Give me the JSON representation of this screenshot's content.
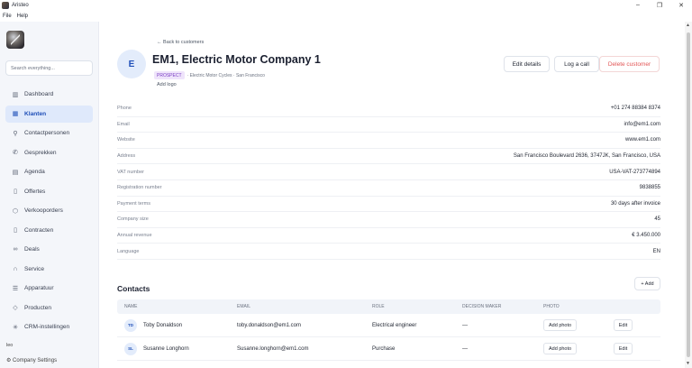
{
  "window": {
    "title": "Aristeo",
    "minimize": "–",
    "maximize": "❐",
    "close": "✕"
  },
  "menu": [
    "File",
    "Help"
  ],
  "sidebar": {
    "search_placeholder": "Search everything...",
    "items": [
      {
        "label": "Dashboard",
        "icon": "bar-chart-icon",
        "glyph": "▥"
      },
      {
        "label": "Klanten",
        "icon": "building-icon",
        "glyph": "▦",
        "active": true
      },
      {
        "label": "Contactpersonen",
        "icon": "person-icon",
        "glyph": "⚲"
      },
      {
        "label": "Gesprekken",
        "icon": "phone-icon",
        "glyph": "✆"
      },
      {
        "label": "Agenda",
        "icon": "calendar-icon",
        "glyph": "▤"
      },
      {
        "label": "Offertes",
        "icon": "document-icon",
        "glyph": "▯"
      },
      {
        "label": "Verkooporders",
        "icon": "box-icon",
        "glyph": "⬡"
      },
      {
        "label": "Contracten",
        "icon": "contract-icon",
        "glyph": "▯"
      },
      {
        "label": "Deals",
        "icon": "handshake-icon",
        "glyph": "∞"
      },
      {
        "label": "Service",
        "icon": "headset-icon",
        "glyph": "∩"
      },
      {
        "label": "Apparatuur",
        "icon": "server-icon",
        "glyph": "☰"
      },
      {
        "label": "Producten",
        "icon": "tag-icon",
        "glyph": "◇"
      },
      {
        "label": "CRM-instellingen",
        "icon": "gear-icon",
        "glyph": "✳"
      }
    ],
    "user": "leo",
    "company_settings": "Company Settings"
  },
  "header": {
    "back": "← Back to customers",
    "avatar_letter": "E",
    "title": "EM1, Electric Motor Company 1",
    "badge": "PROSPECT",
    "subtitle": "· Electric Motor Cycles · San Francisco",
    "add_logo": "Add logo",
    "buttons": {
      "edit": "Edit details",
      "log_call": "Log a call",
      "delete": "Delete customer"
    }
  },
  "fields": [
    {
      "label": "Phone",
      "value": "+01 274 88384 8374"
    },
    {
      "label": "Email",
      "value": "info@em1.com"
    },
    {
      "label": "Website",
      "value": "www.em1.com"
    },
    {
      "label": "Address",
      "value": "San Francisco Boulevard 2636, 3747JK, San Francisco, USA"
    },
    {
      "label": "VAT number",
      "value": "USA-VAT-273774894"
    },
    {
      "label": "Registration number",
      "value": "9838855"
    },
    {
      "label": "Payment terms",
      "value": "30 days after invoice"
    },
    {
      "label": "Company size",
      "value": "45"
    },
    {
      "label": "Annual revenue",
      "value": "€ 3.450.000"
    },
    {
      "label": "Language",
      "value": "EN"
    }
  ],
  "contacts": {
    "title": "Contacts",
    "add": "+ Add",
    "columns": [
      "NAME",
      "EMAIL",
      "ROLE",
      "DECISION MAKER",
      "PHOTO"
    ],
    "rows": [
      {
        "initials": "TD",
        "name": "Toby Donaldson",
        "email": "toby.donaldson@em1.com",
        "role": "Electrical engineer",
        "decision": "—",
        "photo": "Add photo",
        "edit": "Edit"
      },
      {
        "initials": "SL",
        "name": "Susanne Longhorn",
        "email": "Susanne.longhorn@em1.com",
        "role": "Purchase",
        "decision": "—",
        "photo": "Add photo",
        "edit": "Edit"
      }
    ]
  }
}
